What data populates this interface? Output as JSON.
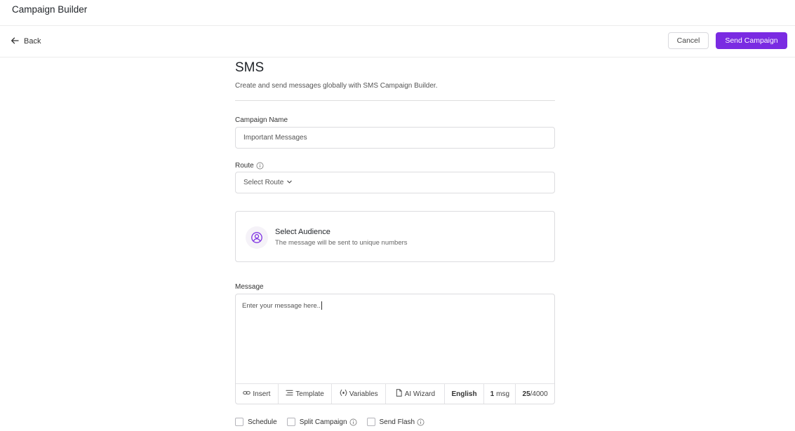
{
  "app": {
    "title": "Campaign Builder"
  },
  "actions": {
    "back_label": "Back",
    "cancel_label": "Cancel",
    "send_label": "Send Campaign"
  },
  "page": {
    "title": "SMS",
    "subtitle": "Create and send messages globally with SMS Campaign Builder."
  },
  "form": {
    "campaign_name": {
      "label": "Campaign Name",
      "value": "Important Messages"
    },
    "route": {
      "label": "Route",
      "placeholder": "Select Route"
    },
    "audience": {
      "title": "Select Audience",
      "subtitle": "The message will be sent to unique numbers"
    },
    "message": {
      "label": "Message",
      "placeholder": "Enter your message here.."
    }
  },
  "toolbar": {
    "insert": "Insert",
    "template": "Template",
    "variables": "Variables",
    "ai_wizard": "AI Wizard",
    "language": "English",
    "msg_count": "1",
    "msg_unit": "msg",
    "char_count": "25",
    "char_limit": "/4000"
  },
  "options": {
    "schedule": "Schedule",
    "split_campaign": "Split Campaign",
    "send_flash": "Send Flash"
  },
  "colors": {
    "accent": "#7a2be2",
    "border": "#dcdcdf"
  }
}
